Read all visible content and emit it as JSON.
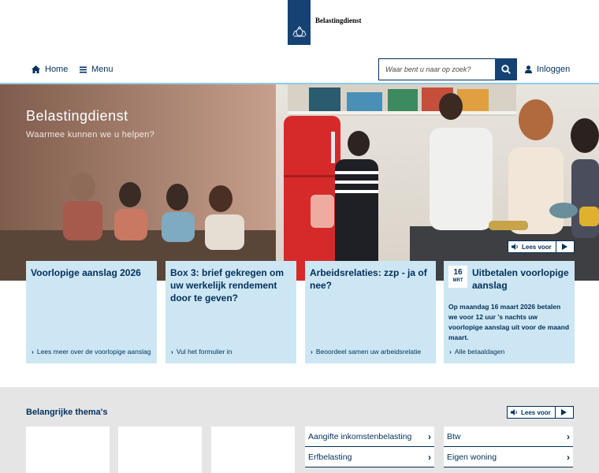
{
  "header": {
    "logo_text": "Belastingdienst"
  },
  "nav": {
    "home": "Home",
    "menu": "Menu",
    "search_placeholder": "Waar bent u naar op zoek?",
    "login": "Inloggen"
  },
  "hero": {
    "title": "Belastingdienst",
    "subtitle": "Waarmee kunnen we u helpen?",
    "read_aloud": "Lees voor"
  },
  "cards": [
    {
      "title": "Voorlopige aanslag 2026",
      "link": "Lees meer over de voorlopige aanslag"
    },
    {
      "title": "Box 3: brief gekregen om uw werkelijk rendement door te geven?",
      "link": "Vul het formulier in"
    },
    {
      "title": "Arbeidsrelaties: zzp - ja of nee?",
      "link": "Beoordeel samen uw arbeidsrelatie"
    },
    {
      "date_day": "16",
      "date_month": "MRT",
      "title": "Uitbetalen voorlopige aanslag",
      "body": "Op maandag 16 maart 2026 betalen we voor 12 uur 's nachts uw voorlopige aanslag uit voor de maand maart.",
      "link": "Alle betaaldagen"
    }
  ],
  "themes": {
    "title": "Belangrijke thema's",
    "read_aloud": "Lees voor",
    "links": [
      "Aangifte inkomstenbelasting",
      "Btw",
      "Erfbelasting",
      "Eigen woning"
    ]
  },
  "colors": {
    "primary": "#154273",
    "text": "#01305c",
    "card_bg": "#cde6f3",
    "accent_line": "#8fcae7",
    "section_bg": "#e5e5e5"
  }
}
